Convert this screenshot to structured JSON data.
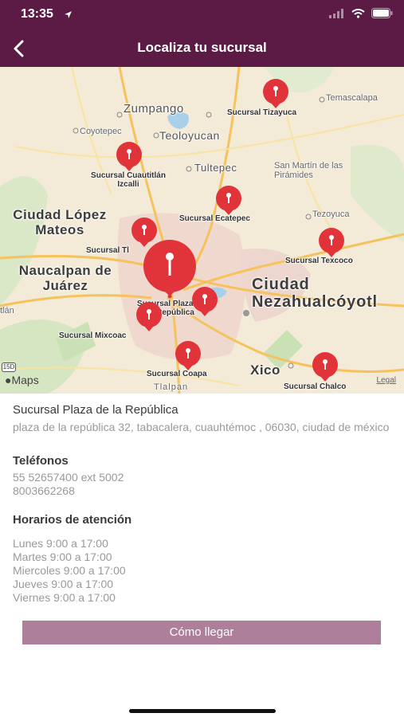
{
  "status_bar": {
    "time": "13:35"
  },
  "header": {
    "title": "Localiza tu sucursal"
  },
  "map": {
    "towns": [
      "Zumpango",
      "Teoloyucan",
      "Coyotepec",
      "Tultepec",
      "Tezoyuca",
      "Temascalapa",
      "San Martín de las Pirámides",
      "Tlalpan"
    ],
    "big_labels": [
      "Ciudad López Mateos",
      "Naucalpan de Juárez",
      "Xico"
    ],
    "city_label": "Ciudad Nezahualcóyotl",
    "branches": [
      "Sucursal Tizayuca",
      "Sucursal Cuautitlán Izcalli",
      "Sucursal Ecatepec",
      "Sucursal Texcoco",
      "Sucursal Tl",
      "Sucursal Plaza de la República",
      "Sucursal Mixcoac",
      "Sucursal Coapa",
      "Sucursal Chalco"
    ],
    "small_labels": [
      "tlán"
    ],
    "highway_number": "15D",
    "maps_logo": "Maps",
    "legal": "Legal"
  },
  "details": {
    "branch_name": "Sucursal Plaza de la República",
    "address": "plaza de la república  32, tabacalera, cuauhtémoc , 06030, ciudad de méxico",
    "phones_title": "Teléfonos",
    "phones": [
      "55 52657400 ext 5002",
      "8003662268"
    ],
    "hours_title": "Horarios de atención",
    "hours": [
      "Lunes 9:00 a 17:00",
      "Martes 9:00 a 17:00",
      "Miercoles 9:00 a 17:00",
      "Jueves 9:00 a 17:00",
      "Viernes 9:00 a 17:00"
    ]
  },
  "action": {
    "route_button": "Cómo llegar"
  },
  "colors": {
    "header": "#5c1b45",
    "button": "#ad7f9a",
    "pin": "#e0333a"
  }
}
